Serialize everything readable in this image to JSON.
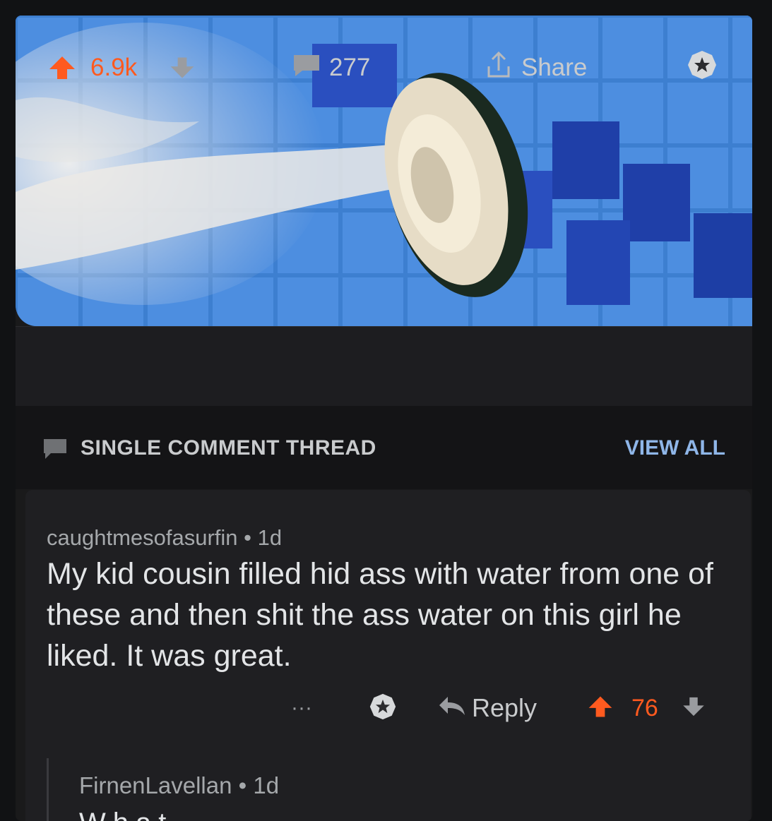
{
  "post": {
    "upvotes": "6.9k",
    "comments": "277",
    "share_label": "Share"
  },
  "thread": {
    "label": "SINGLE COMMENT THREAD",
    "view_all": "VIEW ALL"
  },
  "comment": {
    "author": "caughtmesofasurfin",
    "time": "1d",
    "body": "My kid cousin filled hid ass with water from one of these and then shit the ass water on this girl he liked. It was great.",
    "more": "···",
    "reply_label": "Reply",
    "score": "76"
  },
  "reply": {
    "author": "FirnenLavellan",
    "time": "1d",
    "body": "What"
  },
  "colors": {
    "upvote": "#ff5a1f",
    "link": "#8fb6e8",
    "background": "#1a1a1b"
  }
}
